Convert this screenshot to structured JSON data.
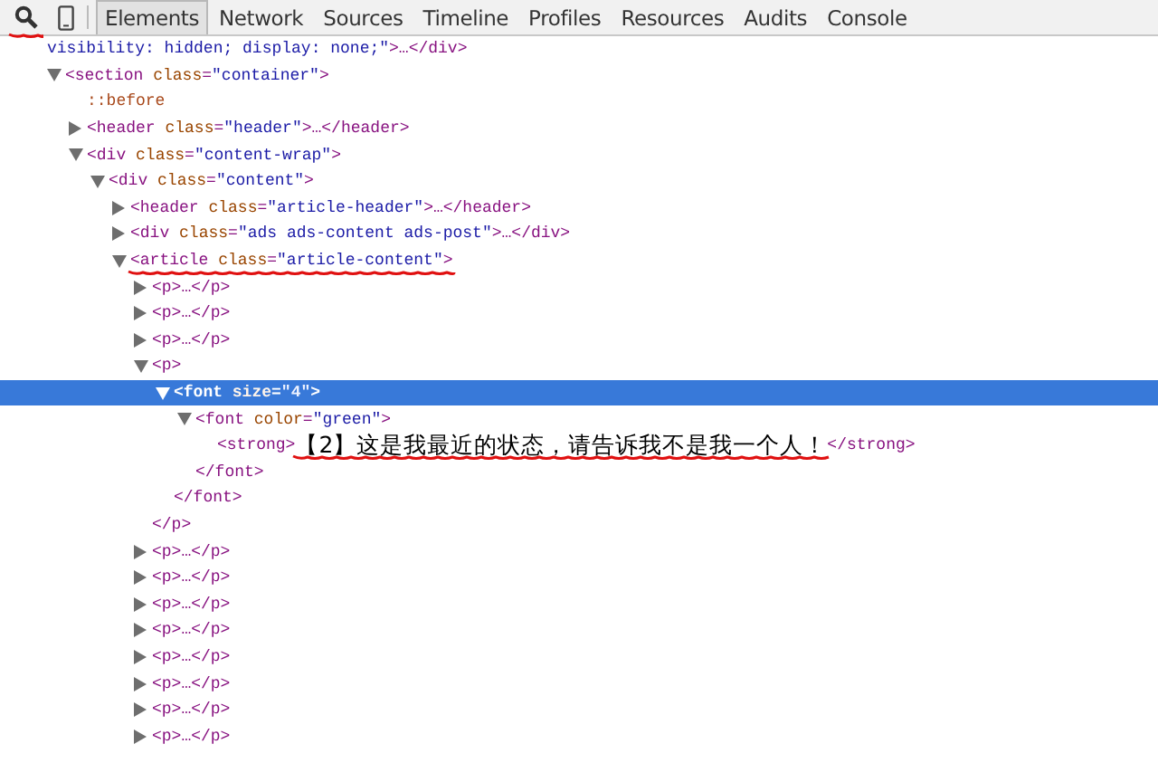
{
  "toolbar": {
    "icons": [
      {
        "kind": "search",
        "annotated": true
      },
      {
        "kind": "device",
        "annotated": false
      }
    ],
    "tabs": [
      {
        "label": "Elements",
        "selected": true
      },
      {
        "label": "Network",
        "selected": false
      },
      {
        "label": "Sources",
        "selected": false
      },
      {
        "label": "Timeline",
        "selected": false
      },
      {
        "label": "Profiles",
        "selected": false
      },
      {
        "label": "Resources",
        "selected": false
      },
      {
        "label": "Audits",
        "selected": false
      },
      {
        "label": "Console",
        "selected": false
      }
    ]
  },
  "tree": [
    {
      "kind": "wrap",
      "expandable": false,
      "selected": false,
      "tokens": [
        {
          "kind": "value",
          "text": "visibility: hidden; display: none;\""
        },
        {
          "kind": "tag",
          "text": ">…</div>"
        }
      ]
    },
    {
      "expandable": true,
      "expanded": true,
      "selected": false,
      "tokens": [
        {
          "kind": "tag",
          "text": "<section "
        },
        {
          "kind": "attr",
          "text": "class"
        },
        {
          "kind": "tag",
          "text": "="
        },
        {
          "kind": "value",
          "text": "\"container\""
        },
        {
          "kind": "tag",
          "text": ">"
        }
      ],
      "children": [
        {
          "expandable": false,
          "selected": false,
          "tokens": [
            {
              "kind": "pseudo",
              "text": "::before"
            }
          ]
        },
        {
          "expandable": true,
          "expanded": false,
          "selected": false,
          "tokens": [
            {
              "kind": "tag",
              "text": "<header "
            },
            {
              "kind": "attr",
              "text": "class"
            },
            {
              "kind": "tag",
              "text": "="
            },
            {
              "kind": "value",
              "text": "\"header\""
            },
            {
              "kind": "tag",
              "text": ">…</header>"
            }
          ]
        },
        {
          "expandable": true,
          "expanded": true,
          "selected": false,
          "tokens": [
            {
              "kind": "tag",
              "text": "<div "
            },
            {
              "kind": "attr",
              "text": "class"
            },
            {
              "kind": "tag",
              "text": "="
            },
            {
              "kind": "value",
              "text": "\"content-wrap\""
            },
            {
              "kind": "tag",
              "text": ">"
            }
          ],
          "children": [
            {
              "expandable": true,
              "expanded": true,
              "selected": false,
              "tokens": [
                {
                  "kind": "tag",
                  "text": "<div "
                },
                {
                  "kind": "attr",
                  "text": "class"
                },
                {
                  "kind": "tag",
                  "text": "="
                },
                {
                  "kind": "value",
                  "text": "\"content\""
                },
                {
                  "kind": "tag",
                  "text": ">"
                }
              ],
              "children": [
                {
                  "expandable": true,
                  "expanded": false,
                  "selected": false,
                  "tokens": [
                    {
                      "kind": "tag",
                      "text": "<header "
                    },
                    {
                      "kind": "attr",
                      "text": "class"
                    },
                    {
                      "kind": "tag",
                      "text": "="
                    },
                    {
                      "kind": "value",
                      "text": "\"article-header\""
                    },
                    {
                      "kind": "tag",
                      "text": ">…</header>"
                    }
                  ]
                },
                {
                  "expandable": true,
                  "expanded": false,
                  "selected": false,
                  "tokens": [
                    {
                      "kind": "tag",
                      "text": "<div "
                    },
                    {
                      "kind": "attr",
                      "text": "class"
                    },
                    {
                      "kind": "tag",
                      "text": "="
                    },
                    {
                      "kind": "value",
                      "text": "\"ads ads-content ads-post\""
                    },
                    {
                      "kind": "tag",
                      "text": ">…</div>"
                    }
                  ]
                },
                {
                  "expandable": true,
                  "expanded": true,
                  "selected": false,
                  "annotated": true,
                  "tokens": [
                    {
                      "kind": "tag",
                      "text": "<article "
                    },
                    {
                      "kind": "attr",
                      "text": "class"
                    },
                    {
                      "kind": "tag",
                      "text": "="
                    },
                    {
                      "kind": "value",
                      "text": "\"article-content\""
                    },
                    {
                      "kind": "tag",
                      "text": ">"
                    }
                  ],
                  "children": [
                    {
                      "expandable": true,
                      "expanded": false,
                      "selected": false,
                      "tokens": [
                        {
                          "kind": "tag",
                          "text": "<p>…</p>"
                        }
                      ]
                    },
                    {
                      "expandable": true,
                      "expanded": false,
                      "selected": false,
                      "tokens": [
                        {
                          "kind": "tag",
                          "text": "<p>…</p>"
                        }
                      ]
                    },
                    {
                      "expandable": true,
                      "expanded": false,
                      "selected": false,
                      "tokens": [
                        {
                          "kind": "tag",
                          "text": "<p>…</p>"
                        }
                      ]
                    },
                    {
                      "expandable": true,
                      "expanded": true,
                      "selected": false,
                      "close": "</p>",
                      "tokens": [
                        {
                          "kind": "tag",
                          "text": "<p>"
                        }
                      ],
                      "children": [
                        {
                          "expandable": true,
                          "expanded": true,
                          "selected": true,
                          "close": "</font>",
                          "tokens": [
                            {
                              "kind": "tag",
                              "text": "<font "
                            },
                            {
                              "kind": "attr",
                              "text": "size"
                            },
                            {
                              "kind": "tag",
                              "text": "="
                            },
                            {
                              "kind": "value",
                              "text": "\"4\""
                            },
                            {
                              "kind": "tag",
                              "text": ">"
                            }
                          ],
                          "children": [
                            {
                              "expandable": true,
                              "expanded": true,
                              "selected": false,
                              "close": "</font>",
                              "tokens": [
                                {
                                  "kind": "tag",
                                  "text": "<font "
                                },
                                {
                                  "kind": "attr",
                                  "text": "color"
                                },
                                {
                                  "kind": "tag",
                                  "text": "="
                                },
                                {
                                  "kind": "value",
                                  "text": "\"green\""
                                },
                                {
                                  "kind": "tag",
                                  "text": ">"
                                }
                              ],
                              "children": [
                                {
                                  "expandable": false,
                                  "selected": false,
                                  "tokens": [
                                    {
                                      "kind": "tag",
                                      "text": "<strong>"
                                    },
                                    {
                                      "kind": "text",
                                      "text": "【2】这是我最近的状态，请告诉我不是我一个人！",
                                      "annotated": true
                                    },
                                    {
                                      "kind": "tag",
                                      "text": "</strong>"
                                    }
                                  ]
                                }
                              ]
                            }
                          ]
                        }
                      ]
                    },
                    {
                      "expandable": true,
                      "expanded": false,
                      "selected": false,
                      "tokens": [
                        {
                          "kind": "tag",
                          "text": "<p>…</p>"
                        }
                      ]
                    },
                    {
                      "expandable": true,
                      "expanded": false,
                      "selected": false,
                      "tokens": [
                        {
                          "kind": "tag",
                          "text": "<p>…</p>"
                        }
                      ]
                    },
                    {
                      "expandable": true,
                      "expanded": false,
                      "selected": false,
                      "tokens": [
                        {
                          "kind": "tag",
                          "text": "<p>…</p>"
                        }
                      ]
                    },
                    {
                      "expandable": true,
                      "expanded": false,
                      "selected": false,
                      "tokens": [
                        {
                          "kind": "tag",
                          "text": "<p>…</p>"
                        }
                      ]
                    },
                    {
                      "expandable": true,
                      "expanded": false,
                      "selected": false,
                      "tokens": [
                        {
                          "kind": "tag",
                          "text": "<p>…</p>"
                        }
                      ]
                    },
                    {
                      "expandable": true,
                      "expanded": false,
                      "selected": false,
                      "tokens": [
                        {
                          "kind": "tag",
                          "text": "<p>…</p>"
                        }
                      ]
                    },
                    {
                      "expandable": true,
                      "expanded": false,
                      "selected": false,
                      "tokens": [
                        {
                          "kind": "tag",
                          "text": "<p>…</p>"
                        }
                      ]
                    },
                    {
                      "expandable": true,
                      "expanded": false,
                      "selected": false,
                      "tokens": [
                        {
                          "kind": "tag",
                          "text": "<p>…</p>"
                        }
                      ]
                    }
                  ]
                }
              ]
            }
          ]
        }
      ]
    }
  ]
}
